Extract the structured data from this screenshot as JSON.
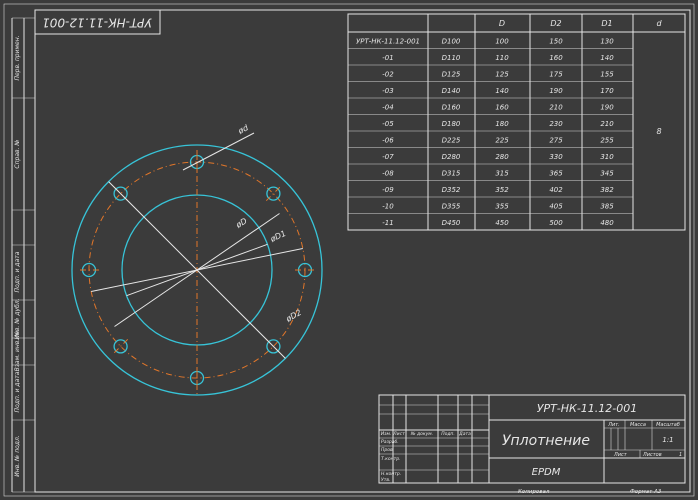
{
  "stamp_top": "УРТ-НК-11.12-001",
  "side_labels": [
    "Перв. примен.",
    "Справ. №",
    "Подп. и дата",
    "Инв. № дубл.",
    "Взам. инв. №",
    "Подп. и дата",
    "Инв. № подл."
  ],
  "table": {
    "headers": [
      "",
      "",
      "D",
      "D2",
      "D1",
      "d"
    ],
    "rows": [
      [
        "УРТ-НК-11.12-001",
        "D100",
        "100",
        "150",
        "130"
      ],
      [
        "-01",
        "D110",
        "110",
        "160",
        "140"
      ],
      [
        "-02",
        "D125",
        "125",
        "175",
        "155"
      ],
      [
        "-03",
        "D140",
        "140",
        "190",
        "170"
      ],
      [
        "-04",
        "D160",
        "160",
        "210",
        "190"
      ],
      [
        "-05",
        "D180",
        "180",
        "230",
        "210"
      ],
      [
        "-06",
        "D225",
        "225",
        "275",
        "255"
      ],
      [
        "-07",
        "D280",
        "280",
        "330",
        "310"
      ],
      [
        "-08",
        "D315",
        "315",
        "365",
        "345"
      ],
      [
        "-09",
        "D352",
        "352",
        "402",
        "382"
      ],
      [
        "-10",
        "D355",
        "355",
        "405",
        "385"
      ],
      [
        "-11",
        "D450",
        "450",
        "500",
        "480"
      ]
    ],
    "d_value": "8"
  },
  "dims": {
    "d": "ød",
    "D": "øD",
    "D1": "øD1",
    "D2": "øD2"
  },
  "title_block": {
    "code": "УРТ-НК-11.12-001",
    "name": "Уплотнение",
    "material": "EPDM",
    "col_labels": [
      "Изм.",
      "Лист",
      "№ докум.",
      "Подп.",
      "Дата"
    ],
    "row_labels": [
      "Разраб.",
      "Пров.",
      "Т.контр.",
      "Н.контр.",
      "Утв."
    ],
    "lit_label": "Лит.",
    "mass_label": "Масса",
    "scale_label": "Масштаб",
    "scale_value": "1:1",
    "sheet_label": "Лист",
    "sheets_label": "Листов",
    "sheets_value": "1",
    "copied": "Копировал",
    "format": "Формат A3"
  }
}
